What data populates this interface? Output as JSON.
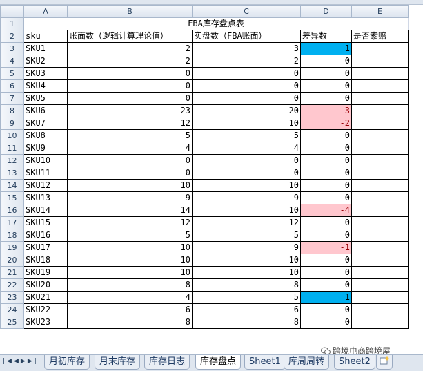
{
  "columns": [
    "A",
    "B",
    "C",
    "D",
    "E"
  ],
  "title_row": {
    "num": "1",
    "text": "FBA库存盘点表"
  },
  "header_row": {
    "num": "2",
    "sku": "sku",
    "book": "账面数（逻辑计算理论值）",
    "actual": "实盘数（FBA账面）",
    "diff": "差异数",
    "claim": "是否索赔"
  },
  "rows": [
    {
      "num": "3",
      "sku": "SKU1",
      "book": "2",
      "actual": "3",
      "diff": "1",
      "flag": "positive"
    },
    {
      "num": "4",
      "sku": "SKU2",
      "book": "2",
      "actual": "2",
      "diff": "0",
      "flag": "none"
    },
    {
      "num": "5",
      "sku": "SKU3",
      "book": "0",
      "actual": "0",
      "diff": "0",
      "flag": "none"
    },
    {
      "num": "6",
      "sku": "SKU4",
      "book": "0",
      "actual": "0",
      "diff": "0",
      "flag": "none"
    },
    {
      "num": "7",
      "sku": "SKU5",
      "book": "0",
      "actual": "0",
      "diff": "0",
      "flag": "none"
    },
    {
      "num": "8",
      "sku": "SKU6",
      "book": "23",
      "actual": "20",
      "diff": "-3",
      "flag": "negative"
    },
    {
      "num": "9",
      "sku": "SKU7",
      "book": "12",
      "actual": "10",
      "diff": "-2",
      "flag": "negative"
    },
    {
      "num": "10",
      "sku": "SKU8",
      "book": "5",
      "actual": "5",
      "diff": "0",
      "flag": "none"
    },
    {
      "num": "11",
      "sku": "SKU9",
      "book": "4",
      "actual": "4",
      "diff": "0",
      "flag": "none"
    },
    {
      "num": "12",
      "sku": "SKU10",
      "book": "0",
      "actual": "0",
      "diff": "0",
      "flag": "none"
    },
    {
      "num": "13",
      "sku": "SKU11",
      "book": "0",
      "actual": "0",
      "diff": "0",
      "flag": "none"
    },
    {
      "num": "14",
      "sku": "SKU12",
      "book": "10",
      "actual": "10",
      "diff": "0",
      "flag": "none"
    },
    {
      "num": "15",
      "sku": "SKU13",
      "book": "9",
      "actual": "9",
      "diff": "0",
      "flag": "none"
    },
    {
      "num": "16",
      "sku": "SKU14",
      "book": "14",
      "actual": "10",
      "diff": "-4",
      "flag": "negative"
    },
    {
      "num": "17",
      "sku": "SKU15",
      "book": "12",
      "actual": "12",
      "diff": "0",
      "flag": "none"
    },
    {
      "num": "18",
      "sku": "SKU16",
      "book": "5",
      "actual": "5",
      "diff": "0",
      "flag": "none"
    },
    {
      "num": "19",
      "sku": "SKU17",
      "book": "10",
      "actual": "9",
      "diff": "-1",
      "flag": "negative"
    },
    {
      "num": "20",
      "sku": "SKU18",
      "book": "10",
      "actual": "10",
      "diff": "0",
      "flag": "none"
    },
    {
      "num": "21",
      "sku": "SKU19",
      "book": "10",
      "actual": "10",
      "diff": "0",
      "flag": "none"
    },
    {
      "num": "22",
      "sku": "SKU20",
      "book": "8",
      "actual": "8",
      "diff": "0",
      "flag": "none"
    },
    {
      "num": "23",
      "sku": "SKU21",
      "book": "4",
      "actual": "5",
      "diff": "1",
      "flag": "positive"
    },
    {
      "num": "24",
      "sku": "SKU22",
      "book": "6",
      "actual": "6",
      "diff": "0",
      "flag": "none"
    },
    {
      "num": "25",
      "sku": "SKU23",
      "book": "8",
      "actual": "8",
      "diff": "0",
      "flag": "none"
    }
  ],
  "colors": {
    "positive": "#00b0f0",
    "negative": "#ffc7ce",
    "negative_text": "#9c0006"
  },
  "sheet_tabs": [
    "月初库存",
    "月末库存",
    "库存日志",
    "库存盘点",
    "Sheet1",
    "库周周转",
    "Sheet2"
  ],
  "active_tab": "库存盘点",
  "nav_icons": [
    "first-sheet-icon",
    "prev-sheet-icon",
    "next-sheet-icon",
    "last-sheet-icon"
  ],
  "watermark": "跨境电商跨境屋"
}
